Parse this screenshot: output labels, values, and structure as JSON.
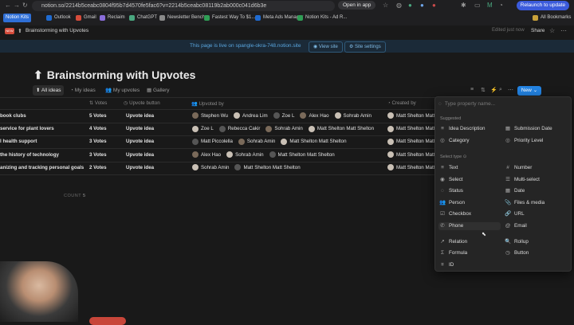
{
  "browser": {
    "url": "notion.so/2214b5ceabc0804f95b7d4570fe5fac6?v=2214b5ceabc08119b2ab000c041d6b3e",
    "open_in_app": "Open in app",
    "relaunch": "Relaunch to update",
    "bookmarks": [
      {
        "label": "Notion Kits",
        "color": "#2f6fd6",
        "box": true
      },
      {
        "label": "Outlook",
        "color": "#1f6bd1"
      },
      {
        "label": "Gmail",
        "color": "#d64c3b"
      },
      {
        "label": "Reclaim",
        "color": "#8a6dd9"
      },
      {
        "label": "ChatGPT",
        "color": "#4aa77f"
      },
      {
        "label": "Newsletter Bench...",
        "color": "#8a8a8a"
      },
      {
        "label": "Fastest Way To $1...",
        "color": "#2f9e55"
      },
      {
        "label": "Meta Ads Manager",
        "color": "#1f6bd1"
      },
      {
        "label": "Notion Kits - Ad R...",
        "color": "#2f9e55"
      }
    ],
    "all_bookmarks": "All Bookmarks"
  },
  "topbar": {
    "breadcrumb": "Brainstorming with Upvotes",
    "edited": "Edited just now",
    "share": "Share"
  },
  "banner": {
    "text": "This page is live on spangle-okra-748.notion.site",
    "view_site": "View site",
    "site_settings": "Site settings"
  },
  "page": {
    "title": "Brainstorming with Upvotes",
    "tabs": [
      "All ideas",
      "My ideas",
      "My upvotes",
      "Gallery"
    ],
    "new_label": "New"
  },
  "table": {
    "headers": [
      "Votes",
      "Upvote button",
      "Upvoted by",
      "Created by"
    ],
    "rows": [
      {
        "name": "book clubs",
        "votes": "5 Votes",
        "button": "Upvote idea",
        "upvoted": [
          "Stephen Wu",
          "Andrea Lim",
          "Zoe L",
          "Alex Hao",
          "Sohrab Amin"
        ],
        "created": "Matt Shelton Matt"
      },
      {
        "name": "service for plant lovers",
        "votes": "4 Votes",
        "button": "Upvote idea",
        "upvoted": [
          "Zoe L",
          "Rebecca Cakir",
          "Sohrab Amin",
          "Matt Shelton Matt Shelton"
        ],
        "created": "Matt Shelton Matt"
      },
      {
        "name": "l health support",
        "votes": "3 Votes",
        "button": "Upvote idea",
        "upvoted": [
          "Matt Piccolella",
          "Sohrab Amin",
          "Matt Shelton Matt Shelton"
        ],
        "created": "Matt Shelton Matt"
      },
      {
        "name": "the history of technology",
        "votes": "3 Votes",
        "button": "Upvote idea",
        "upvoted": [
          "Alex Hao",
          "Sohrab Amin",
          "Matt Shelton Matt Shelton"
        ],
        "created": "Matt Shelton Matt"
      },
      {
        "name": "anizing and tracking personal goals",
        "votes": "2 Votes",
        "button": "Upvote idea",
        "upvoted": [
          "Sohrab Amin",
          "Matt Shelton Matt Shelton"
        ],
        "created": "Matt Shelton Matt"
      }
    ],
    "count_label": "COUNT",
    "count_value": "5"
  },
  "property_menu": {
    "search_placeholder": "Type property name...",
    "suggested_label": "Suggested",
    "suggested": [
      {
        "label": "Idea Description",
        "icon": "≡"
      },
      {
        "label": "Submission Date",
        "icon": "▦"
      },
      {
        "label": "Category",
        "icon": "◎"
      },
      {
        "label": "Priority Level",
        "icon": "◎"
      }
    ],
    "select_type_label": "Select type",
    "types": [
      {
        "label": "Text",
        "icon": "≡"
      },
      {
        "label": "Number",
        "icon": "#"
      },
      {
        "label": "Select",
        "icon": "◉"
      },
      {
        "label": "Multi-select",
        "icon": "☰"
      },
      {
        "label": "Status",
        "icon": "◌"
      },
      {
        "label": "Date",
        "icon": "▦"
      },
      {
        "label": "Person",
        "icon": "👥"
      },
      {
        "label": "Files & media",
        "icon": "📎"
      },
      {
        "label": "Checkbox",
        "icon": "☑"
      },
      {
        "label": "URL",
        "icon": "🔗"
      },
      {
        "label": "Phone",
        "icon": "✆"
      },
      {
        "label": "Email",
        "icon": "@"
      },
      {
        "label": "Relation",
        "icon": "↗"
      },
      {
        "label": "Rollup",
        "icon": "🔍"
      },
      {
        "label": "Formula",
        "icon": "Σ"
      },
      {
        "label": "Button",
        "icon": "◷"
      },
      {
        "label": "ID",
        "icon": "⌗"
      }
    ]
  }
}
